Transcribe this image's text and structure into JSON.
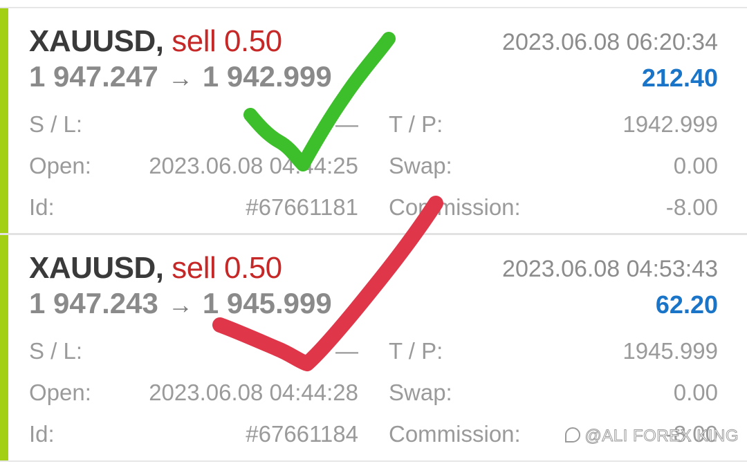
{
  "trades": [
    {
      "symbol": "XAUUSD",
      "comma": ",",
      "side": "sell 0.50",
      "timestamp": "2023.06.08 06:20:34",
      "open_price": "1 947.247",
      "arrow": "→",
      "close_price": "1 942.999",
      "profit": "212.40",
      "fields": {
        "sl_label": "S / L:",
        "sl_value": "—",
        "tp_label": "T / P:",
        "tp_value": "1942.999",
        "open_label": "Open:",
        "open_value": "2023.06.08 04:44:25",
        "swap_label": "Swap:",
        "swap_value": "0.00",
        "id_label": "Id:",
        "id_value": "#67661181",
        "commission_label": "Commission:",
        "commission_value": "-8.00"
      }
    },
    {
      "symbol": "XAUUSD",
      "comma": ",",
      "side": "sell 0.50",
      "timestamp": "2023.06.08 04:53:43",
      "open_price": "1 947.243",
      "arrow": "→",
      "close_price": "1 945.999",
      "profit": "62.20",
      "fields": {
        "sl_label": "S / L:",
        "sl_value": "—",
        "tp_label": "T / P:",
        "tp_value": "1945.999",
        "open_label": "Open:",
        "open_value": "2023.06.08 04:44:28",
        "swap_label": "Swap:",
        "swap_value": "0.00",
        "id_label": "Id:",
        "id_value": "#67661184",
        "commission_label": "Commission:",
        "commission_value": "-8.00"
      }
    }
  ],
  "colors": {
    "accent_bar": "#a3cf14",
    "sell": "#c62828",
    "profit": "#1a74c8",
    "checkmark_green": "#3cbf2a",
    "checkmark_red": "#e0364a"
  },
  "annotations": {
    "checkmark_1": "checkmark-icon",
    "checkmark_2": "checkmark-icon"
  },
  "watermark": {
    "text": "@ALI FOREX KING",
    "icon": "watermark-logo-icon"
  }
}
